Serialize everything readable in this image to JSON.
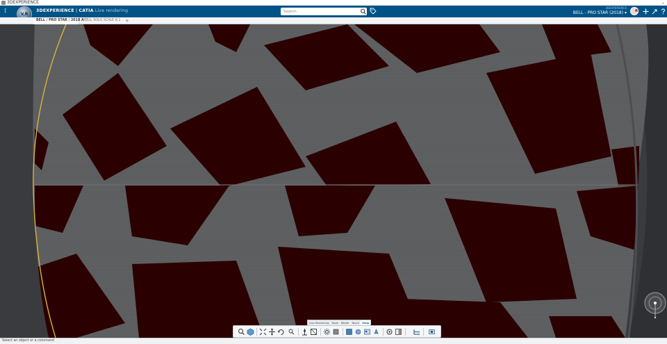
{
  "window": {
    "title": "3DEXPERIENCE",
    "controls": "–"
  },
  "header": {
    "brand": "3DEXPERIENCE",
    "separator": " | ",
    "app_name": "CATIA",
    "app_sub": "Live rendering",
    "compass_letter": "V,R",
    "search_placeholder": "Search",
    "user_line1": "3DEXPERIENCE",
    "user_line2": "BELL - PRO STAR (2018)",
    "user_caret": "▾"
  },
  "tabs": [
    {
      "label": "BELL / PRO STAR / 2018 A",
      "active": true
    },
    {
      "label": "BELL SOLO SCALE A.1",
      "active": false
    }
  ],
  "tab_add": "+",
  "action_bar": {
    "tabs": [
      {
        "label": "Live Rendering",
        "active": false
      },
      {
        "label": "Tools",
        "active": false
      },
      {
        "label": "Model",
        "active": false
      },
      {
        "label": "Touch",
        "active": false
      },
      {
        "label": "View",
        "active": true
      }
    ]
  },
  "viewport": {
    "tile_dark": "#2b0000",
    "tile_light": "#5a5b5d",
    "frame_line": "#d9b43c"
  },
  "status": {
    "text": "Select an object or a command"
  },
  "colors": {
    "topbar": "#005386",
    "accent": "#0b5f98"
  }
}
